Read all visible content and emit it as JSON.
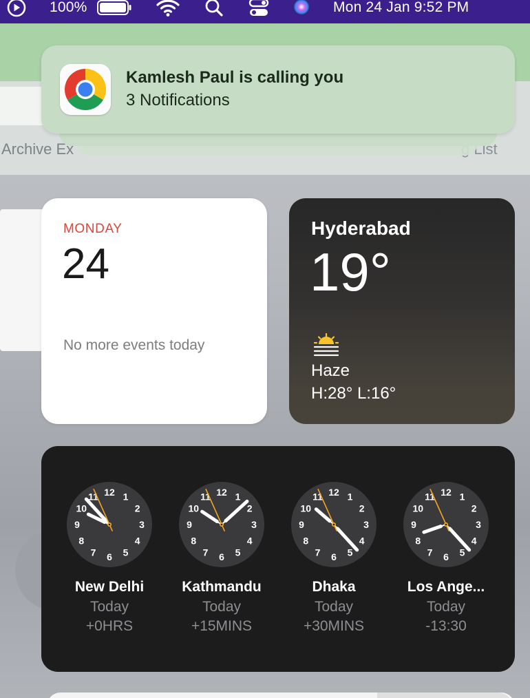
{
  "menubar": {
    "battery": "100%",
    "datetime": "Mon 24 Jan  9:52 PM",
    "icons": [
      "play-circle-icon",
      "battery-icon",
      "wifi-icon",
      "search-icon",
      "control-center-icon",
      "siri-icon"
    ]
  },
  "background_app": {
    "left_text": "Archive Ex",
    "right_text": "g List"
  },
  "notification": {
    "app_icon": "chrome-icon",
    "title": "Kamlesh Paul is calling you",
    "subtitle": "3 Notifications"
  },
  "calendar": {
    "weekday": "MONDAY",
    "date": "24",
    "events_text": "No more events today",
    "accent_color": "#e0433a"
  },
  "weather": {
    "city": "Hyderabad",
    "temperature": "19°",
    "icon": "haze-icon",
    "condition": "Haze",
    "high_low": "H:28° L:16°"
  },
  "world_clock": {
    "clocks": [
      {
        "city": "New Delhi",
        "day": "Today",
        "offset": "+0HRS",
        "hour": 9,
        "minute": 52,
        "second": 56
      },
      {
        "city": "Kathmandu",
        "day": "Today",
        "offset": "+15MINS",
        "hour": 10,
        "minute": 7,
        "second": 56
      },
      {
        "city": "Dhaka",
        "day": "Today",
        "offset": "+30MINS",
        "hour": 10,
        "minute": 22,
        "second": 56
      },
      {
        "city": "Los Ange...",
        "day": "Today",
        "offset": "-13:30",
        "hour": 8,
        "minute": 22,
        "second": 56
      }
    ],
    "numerals": [
      "12",
      "1",
      "2",
      "3",
      "4",
      "5",
      "6",
      "7",
      "8",
      "9",
      "10",
      "11"
    ],
    "second_hand_color": "#f5a623"
  }
}
